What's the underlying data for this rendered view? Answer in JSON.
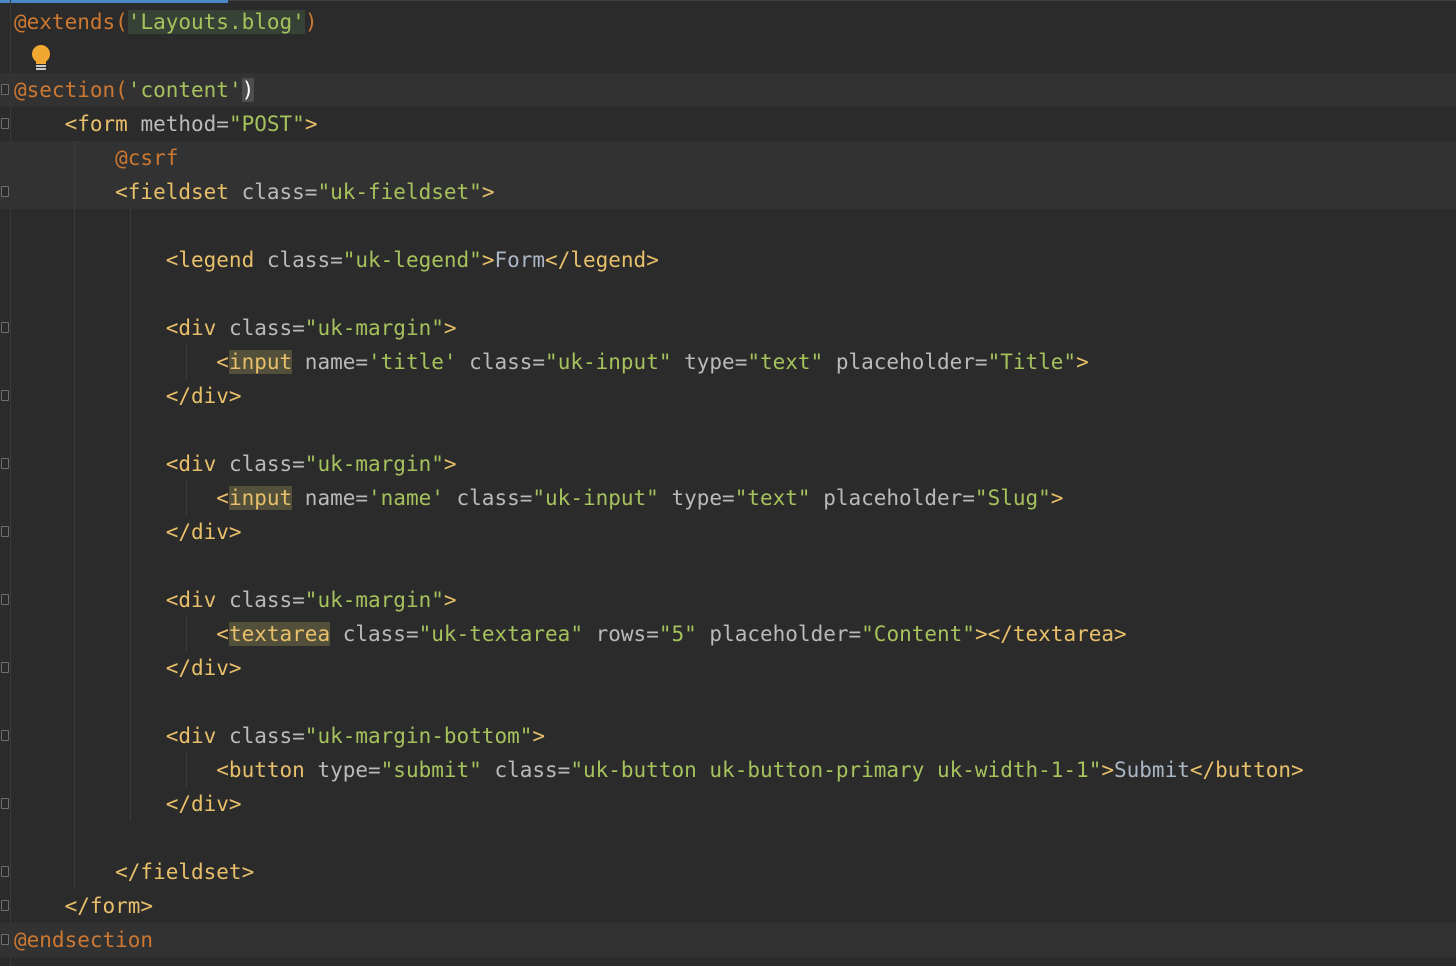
{
  "editor": {
    "lines": [
      {
        "tokens": [
          {
            "c": "k",
            "v": "@extends("
          },
          {
            "c": "s",
            "v": "'Layouts.blog'",
            "bg": "str-bg"
          },
          {
            "c": "k",
            "v": ")"
          }
        ]
      },
      {
        "tokens": [],
        "bulb": true
      },
      {
        "tokens": [
          {
            "c": "k",
            "v": "@section("
          },
          {
            "c": "s",
            "v": "'content'"
          },
          {
            "c": "paren-hl",
            "v": ")"
          }
        ],
        "hl": true,
        "fold": "start"
      },
      {
        "tokens": [
          {
            "c": "t",
            "v": "    <form "
          },
          {
            "c": "a",
            "v": "method="
          },
          {
            "c": "s",
            "v": "\"POST\""
          },
          {
            "c": "t",
            "v": ">"
          }
        ],
        "fold": "start"
      },
      {
        "tokens": [
          {
            "c": "k",
            "v": "        @csrf"
          }
        ],
        "hl": true
      },
      {
        "tokens": [
          {
            "c": "t",
            "v": "        <fieldset "
          },
          {
            "c": "a",
            "v": "class="
          },
          {
            "c": "s",
            "v": "\"uk-fieldset\""
          },
          {
            "c": "t",
            "v": ">"
          }
        ],
        "fold": "start",
        "hl": true
      },
      {
        "tokens": []
      },
      {
        "tokens": [
          {
            "c": "t",
            "v": "            <legend "
          },
          {
            "c": "a",
            "v": "class="
          },
          {
            "c": "s",
            "v": "\"uk-legend\""
          },
          {
            "c": "t",
            "v": ">"
          },
          {
            "c": "tx",
            "v": "Form"
          },
          {
            "c": "t",
            "v": "</legend>"
          }
        ]
      },
      {
        "tokens": []
      },
      {
        "tokens": [
          {
            "c": "t",
            "v": "            <div "
          },
          {
            "c": "a",
            "v": "class="
          },
          {
            "c": "s",
            "v": "\"uk-margin\""
          },
          {
            "c": "t",
            "v": ">"
          }
        ],
        "fold": "start"
      },
      {
        "tokens": [
          {
            "c": "t",
            "v": "                <"
          },
          {
            "c": "t",
            "v": "input",
            "bg": "tag-hl"
          },
          {
            "c": "a",
            "v": " name="
          },
          {
            "c": "s",
            "v": "'title'"
          },
          {
            "c": "a",
            "v": " class="
          },
          {
            "c": "s",
            "v": "\"uk-input\""
          },
          {
            "c": "a",
            "v": " type="
          },
          {
            "c": "s",
            "v": "\"text\""
          },
          {
            "c": "a",
            "v": " placeholder="
          },
          {
            "c": "s",
            "v": "\"Title\""
          },
          {
            "c": "t",
            "v": ">"
          }
        ]
      },
      {
        "tokens": [
          {
            "c": "t",
            "v": "            </div>"
          }
        ],
        "fold": "end"
      },
      {
        "tokens": []
      },
      {
        "tokens": [
          {
            "c": "t",
            "v": "            <div "
          },
          {
            "c": "a",
            "v": "class="
          },
          {
            "c": "s",
            "v": "\"uk-margin\""
          },
          {
            "c": "t",
            "v": ">"
          }
        ],
        "fold": "start"
      },
      {
        "tokens": [
          {
            "c": "t",
            "v": "                <"
          },
          {
            "c": "t",
            "v": "input",
            "bg": "tag-hl"
          },
          {
            "c": "a",
            "v": " name="
          },
          {
            "c": "s",
            "v": "'name'"
          },
          {
            "c": "a",
            "v": " class="
          },
          {
            "c": "s",
            "v": "\"uk-input\""
          },
          {
            "c": "a",
            "v": " type="
          },
          {
            "c": "s",
            "v": "\"text\""
          },
          {
            "c": "a",
            "v": " placeholder="
          },
          {
            "c": "s",
            "v": "\"Slug\""
          },
          {
            "c": "t",
            "v": ">"
          }
        ]
      },
      {
        "tokens": [
          {
            "c": "t",
            "v": "            </div>"
          }
        ],
        "fold": "end"
      },
      {
        "tokens": []
      },
      {
        "tokens": [
          {
            "c": "t",
            "v": "            <div "
          },
          {
            "c": "a",
            "v": "class="
          },
          {
            "c": "s",
            "v": "\"uk-margin\""
          },
          {
            "c": "t",
            "v": ">"
          }
        ],
        "fold": "start"
      },
      {
        "tokens": [
          {
            "c": "t",
            "v": "                <"
          },
          {
            "c": "t",
            "v": "textarea",
            "bg": "tag-hl"
          },
          {
            "c": "a",
            "v": " class="
          },
          {
            "c": "s",
            "v": "\"uk-textarea\""
          },
          {
            "c": "a",
            "v": " rows="
          },
          {
            "c": "s",
            "v": "\"5\""
          },
          {
            "c": "a",
            "v": " placeholder="
          },
          {
            "c": "s",
            "v": "\"Content\""
          },
          {
            "c": "t",
            "v": "></textarea>"
          }
        ]
      },
      {
        "tokens": [
          {
            "c": "t",
            "v": "            </div>"
          }
        ],
        "fold": "end"
      },
      {
        "tokens": []
      },
      {
        "tokens": [
          {
            "c": "t",
            "v": "            <div "
          },
          {
            "c": "a",
            "v": "class="
          },
          {
            "c": "s",
            "v": "\"uk-margin-bottom\""
          },
          {
            "c": "t",
            "v": ">"
          }
        ],
        "fold": "start"
      },
      {
        "tokens": [
          {
            "c": "t",
            "v": "                <button "
          },
          {
            "c": "a",
            "v": "type="
          },
          {
            "c": "s",
            "v": "\"submit\""
          },
          {
            "c": "a",
            "v": " class="
          },
          {
            "c": "s",
            "v": "\"uk-button uk-button-primary uk-width-1-1\""
          },
          {
            "c": "t",
            "v": ">"
          },
          {
            "c": "tx",
            "v": "Submit"
          },
          {
            "c": "t",
            "v": "</button>"
          }
        ]
      },
      {
        "tokens": [
          {
            "c": "t",
            "v": "            </div>"
          }
        ],
        "fold": "end"
      },
      {
        "tokens": []
      },
      {
        "tokens": [
          {
            "c": "t",
            "v": "        </fieldset>"
          }
        ],
        "fold": "end"
      },
      {
        "tokens": [
          {
            "c": "t",
            "v": "    </form>"
          }
        ],
        "fold": "end"
      },
      {
        "tokens": [
          {
            "c": "k",
            "v": "@endsection"
          }
        ],
        "fold": "end",
        "hl": true
      }
    ]
  },
  "colors": {
    "background": "#2b2b2b",
    "keyword": "#cc7832",
    "string": "#a5c25c",
    "tag": "#e8bf6a",
    "attribute": "#bababa",
    "text": "#a9b7c6",
    "accent": "#4a88c7"
  },
  "icons": {
    "bulb": "lightbulb-icon",
    "fold": "fold-marker-icon"
  }
}
